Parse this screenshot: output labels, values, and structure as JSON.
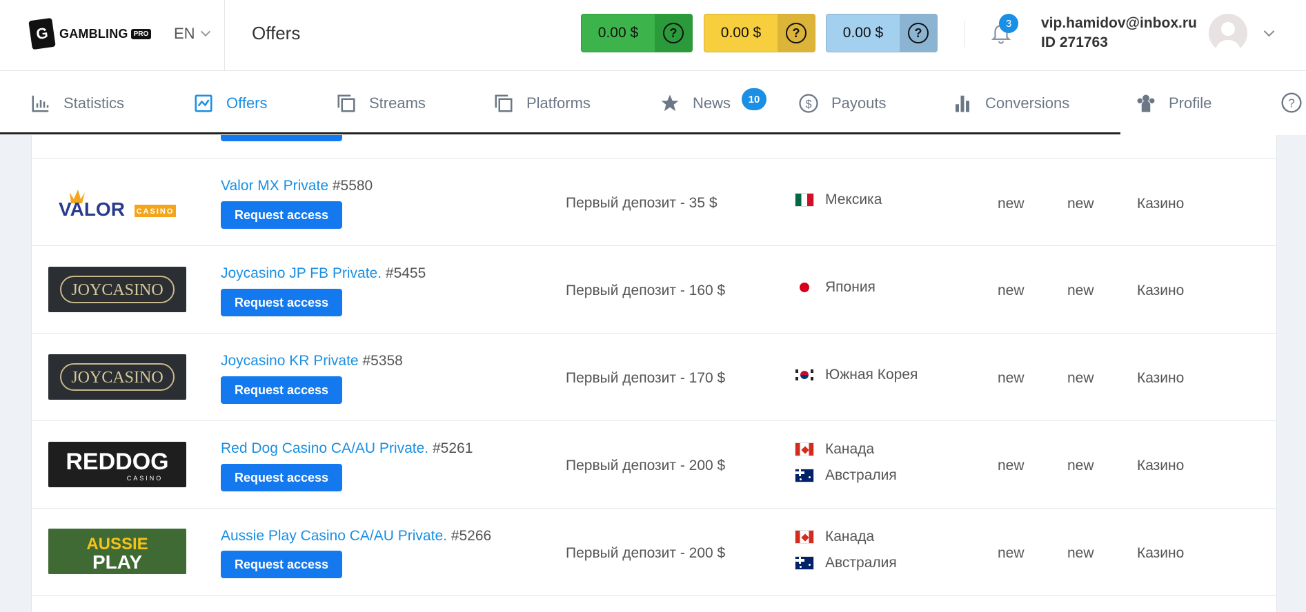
{
  "header": {
    "logo_text": "GAMBLING",
    "logo_pro": "PRO",
    "lang": "EN",
    "title": "Offers",
    "balances": [
      {
        "amount": "0.00 $",
        "color": "#3cb44b"
      },
      {
        "amount": "0.00 $",
        "color": "#f7cf3e"
      },
      {
        "amount": "0.00 $",
        "color": "#a4d0f0"
      }
    ],
    "help_glyph": "?",
    "notifications": "3",
    "email": "vip.hamidov@inbox.ru",
    "user_id": "ID 271763"
  },
  "nav": {
    "items": [
      {
        "label": "Statistics",
        "icon": "bar-chart-icon"
      },
      {
        "label": "Offers",
        "icon": "chart-line-icon",
        "active": true
      },
      {
        "label": "Streams",
        "icon": "copy-icon"
      },
      {
        "label": "Platforms",
        "icon": "copy-icon"
      },
      {
        "label": "News",
        "icon": "star-icon"
      },
      {
        "label": "Payouts",
        "icon": "dollar-icon"
      },
      {
        "label": "Conversions",
        "icon": "bars-icon"
      },
      {
        "label": "Profile",
        "icon": "users-icon"
      }
    ],
    "news_badge": "10"
  },
  "offers": [
    {
      "logo": "VALOR",
      "logo_sub": "CASINO",
      "name": "Valor MX Private",
      "id": "#5580",
      "button": "Request access",
      "deposit": "Первый депозит - 35 $",
      "countries": [
        "Мексика"
      ],
      "c1": "new",
      "c2": "new",
      "category": "Казино"
    },
    {
      "logo": "JOYCASINO",
      "name": "Joycasino JP FB Private.",
      "id": "#5455",
      "button": "Request access",
      "deposit": "Первый депозит - 160 $",
      "countries": [
        "Япония"
      ],
      "c1": "new",
      "c2": "new",
      "category": "Казино"
    },
    {
      "logo": "JOYCASINO",
      "name": "Joycasino KR Private",
      "id": "#5358",
      "button": "Request access",
      "deposit": "Первый депозит - 170 $",
      "countries": [
        "Южная Корея"
      ],
      "c1": "new",
      "c2": "new",
      "category": "Казино"
    },
    {
      "logo": "REDDOG",
      "logo_sub": "CASINO",
      "name": "Red Dog Casino CA/AU Private.",
      "id": "#5261",
      "button": "Request access",
      "deposit": "Первый депозит - 200 $",
      "countries": [
        "Канада",
        "Австралия"
      ],
      "c1": "new",
      "c2": "new",
      "category": "Казино"
    },
    {
      "logo": "AUSSIE",
      "logo_sub": "PLAY",
      "name": "Aussie Play Casino CA/AU Private.",
      "id": "#5266",
      "button": "Request access",
      "deposit": "Первый депозит - 200 $",
      "countries": [
        "Канада",
        "Австралия"
      ],
      "c1": "new",
      "c2": "new",
      "category": "Казино"
    }
  ]
}
